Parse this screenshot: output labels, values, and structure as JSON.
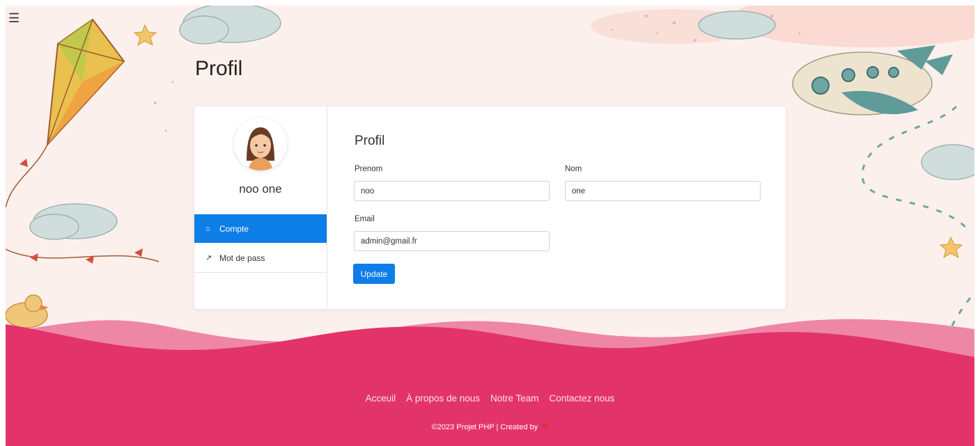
{
  "header": {
    "menu_icon": "hamburger-icon"
  },
  "page": {
    "title": "Profil"
  },
  "sidebar": {
    "user_name": "noo one",
    "items": [
      {
        "label": "Compte",
        "icon": "home-icon",
        "active": true
      },
      {
        "label": "Mot de pass",
        "icon": "key-icon",
        "active": false
      }
    ]
  },
  "form": {
    "title": "Profil",
    "prenom": {
      "label": "Prenom",
      "value": "noo"
    },
    "nom": {
      "label": "Nom",
      "value": "one"
    },
    "email": {
      "label": "Email",
      "value": "admin@gmail.fr"
    },
    "submit_label": "Update"
  },
  "footer": {
    "links": [
      "Acceuil",
      "À propos de nous",
      "Notre Team",
      "Contactez nous"
    ],
    "copyright": "©2023 Projet PHP | Created by",
    "heart_icon": "heart-icon"
  },
  "colors": {
    "primary": "#0d7de8",
    "footer": "#e2336b",
    "background": "#fcf0ec"
  }
}
